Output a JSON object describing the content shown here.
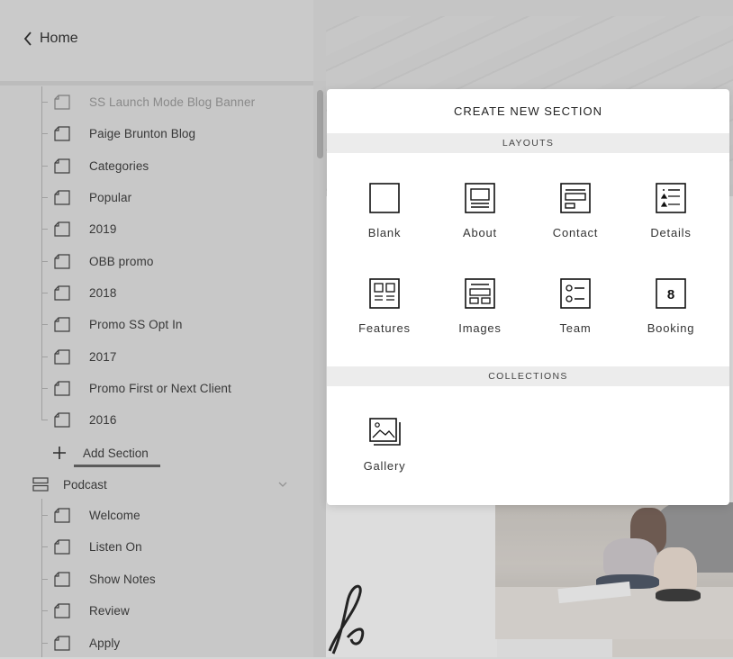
{
  "sidebar": {
    "home_label": "Home",
    "pages": [
      {
        "label": "SS Launch Mode Blog Banner",
        "faded": true
      },
      {
        "label": "Paige Brunton Blog"
      },
      {
        "label": "Categories"
      },
      {
        "label": "Popular"
      },
      {
        "label": "2019"
      },
      {
        "label": "OBB promo"
      },
      {
        "label": "2018"
      },
      {
        "label": "Promo SS Opt In"
      },
      {
        "label": "2017"
      },
      {
        "label": "Promo First or Next Client"
      },
      {
        "label": "2016"
      }
    ],
    "add_section_label": "Add Section",
    "folder": {
      "label": "Podcast"
    },
    "podcast_pages": [
      {
        "label": "Welcome"
      },
      {
        "label": "Listen On"
      },
      {
        "label": "Show Notes"
      },
      {
        "label": "Review"
      },
      {
        "label": "Apply"
      }
    ]
  },
  "modal": {
    "title": "CREATE NEW SECTION",
    "layouts_heading": "LAYOUTS",
    "layouts": [
      {
        "label": "Blank",
        "icon": "blank-layout-icon"
      },
      {
        "label": "About",
        "icon": "about-layout-icon"
      },
      {
        "label": "Contact",
        "icon": "contact-layout-icon"
      },
      {
        "label": "Details",
        "icon": "details-layout-icon"
      },
      {
        "label": "Features",
        "icon": "features-layout-icon"
      },
      {
        "label": "Images",
        "icon": "images-layout-icon"
      },
      {
        "label": "Team",
        "icon": "team-layout-icon"
      },
      {
        "label": "Booking",
        "icon": "booking-layout-icon"
      }
    ],
    "collections_heading": "COLLECTIONS",
    "collections": [
      {
        "label": "Gallery",
        "icon": "gallery-collection-icon"
      }
    ],
    "booking_glyph": "8"
  },
  "colors": {
    "sidebar_bg": "#d9d9d9",
    "modal_bg": "#ffffff",
    "section_bar_bg": "#ececec",
    "text": "#222222"
  }
}
